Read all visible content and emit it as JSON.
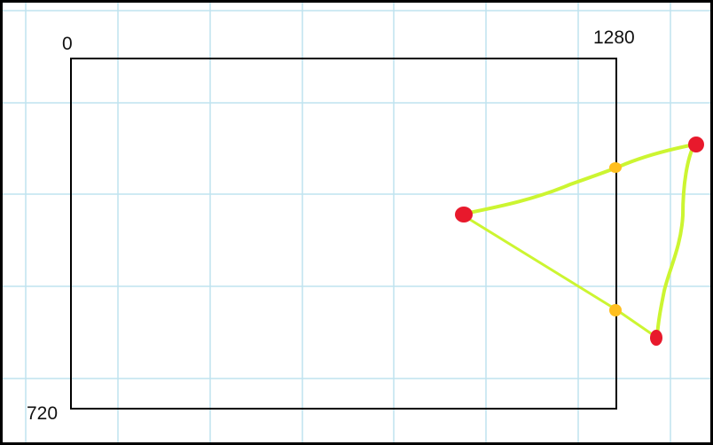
{
  "diagram": {
    "labels": {
      "top_left": "0",
      "top_right": "1280",
      "bottom_left": "720"
    },
    "colors": {
      "grid": "#bfe3ef",
      "frame": "#000000",
      "polygon": "#ccf531",
      "vertex": "#e8192c",
      "intersection": "#ffbf1f"
    }
  }
}
